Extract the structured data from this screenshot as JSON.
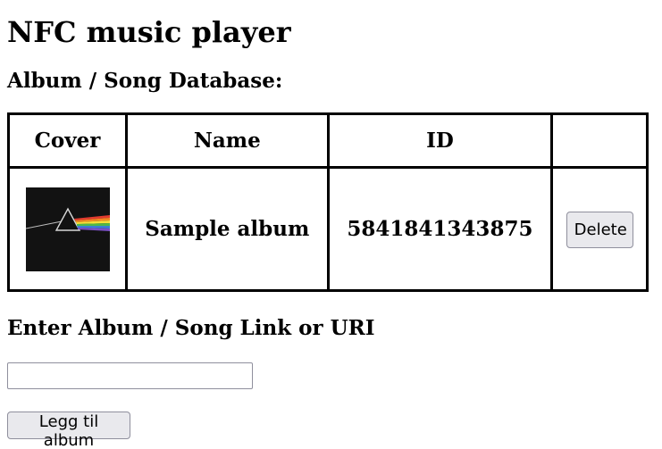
{
  "page": {
    "title": "NFC music player"
  },
  "database": {
    "heading": "Album / Song Database:",
    "columns": [
      "Cover",
      "Name",
      "ID",
      ""
    ],
    "rows": [
      {
        "cover_icon": "album-cover-prism",
        "name": "Sample album",
        "id": "5841841343875",
        "delete_label": "Delete"
      }
    ]
  },
  "add_form": {
    "heading": "Enter Album / Song Link or URI",
    "input_value": "",
    "input_placeholder": "",
    "submit_label": "Legg til album"
  }
}
